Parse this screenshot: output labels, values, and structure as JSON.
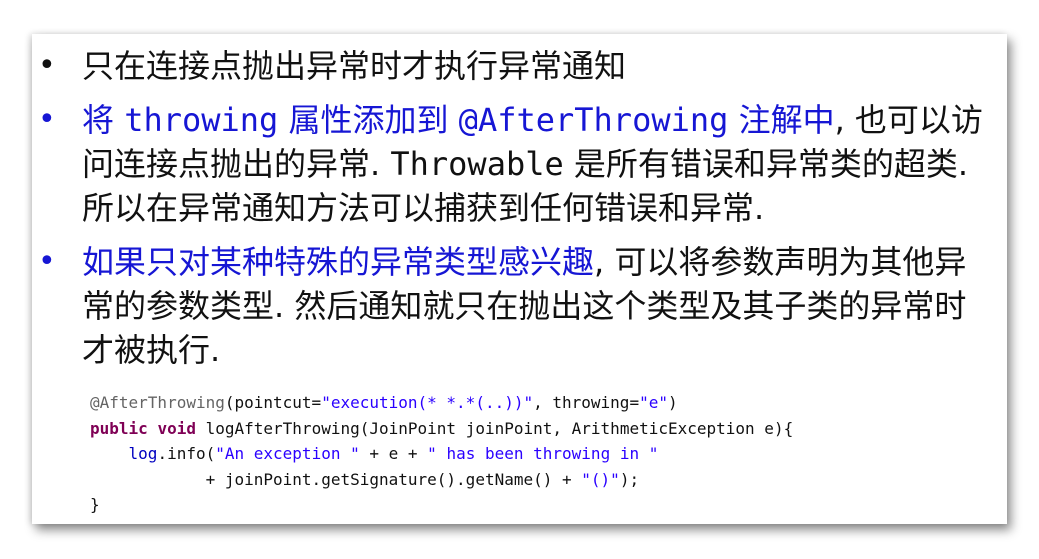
{
  "bullets": [
    {
      "text": "只在连接点抛出异常时才执行异常通知"
    },
    {
      "prefix": "将",
      "prefix_mono": "throwing",
      "mid": "属性添加到",
      "mid_mono": "@AfterThrowing",
      "suffix": "注解中",
      "rest1": ", 也可以访问连接点抛出的异常.",
      "rest_mono": "Throwable",
      "rest2": "是所有错误和异常类的超类. 所以在异常通知方法可以捕获到任何错误和异常."
    },
    {
      "highlight": "如果只对某种特殊的异常类型感兴趣",
      "rest": ", 可以将参数声明为其他异常的参数类型. 然后通知就只在抛出这个类型及其子类的异常时才被执行."
    }
  ],
  "code": {
    "line1_annotation": "@AfterThrowing",
    "line1_a": "(pointcut=",
    "line1_str1": "\"execution(* *.*(..))\"",
    "line1_b": ", throwing=",
    "line1_str2": "\"e\"",
    "line1_c": ")",
    "line2_kw1": "public",
    "line2_kw2": "void",
    "line2_rest": " logAfterThrowing(JoinPoint joinPoint, ArithmeticException e){",
    "line3_indent": "    ",
    "line3_field": "log",
    "line3_a": ".info(",
    "line3_str1": "\"An exception \"",
    "line3_b": " + e + ",
    "line3_str2": "\" has been throwing in \"",
    "line4_indent": "            + joinPoint.getSignature().getName() + ",
    "line4_str": "\"()\"",
    "line4_end": ");",
    "line5": "}"
  },
  "colors": {
    "highlight_blue": "#1616d4",
    "annotation_gray": "#646464",
    "keyword": "#7f0055",
    "string": "#2a00ff"
  }
}
